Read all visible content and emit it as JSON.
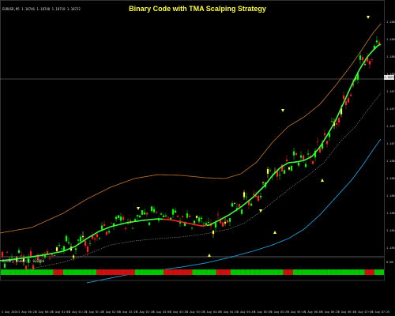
{
  "window": {
    "title": "Binary Code with TMA Scalping Strategy",
    "symbol_info": "EURUSD,M5 1.18746 1.18748 1.18718 1.18722"
  },
  "colors": {
    "background": "#000000",
    "title": "#ffff33",
    "bull_candle": "#00ff00",
    "bear_candle": "#ff2020",
    "neutral_candle": "#ffff44",
    "tma_mid_up": "#44ff44",
    "tma_mid_down": "#ff2a2a",
    "upper_band": "#c8762a",
    "lower_band": "#1e9bd7",
    "inner_band": "#9a9a9a",
    "histogram_green": "#00c800",
    "histogram_red": "#d01010"
  },
  "price_axis": {
    "labels": [
      "1.18895",
      "1.18870",
      "1.18845",
      "1.18820",
      "1.18795",
      "1.18770",
      "1.18745",
      "1.18720",
      "1.18695",
      "1.18670",
      "1.18645",
      "1.18620",
      "1.18595",
      "1.18570"
    ],
    "current_price": "1.18722"
  },
  "time_axis": {
    "labels": [
      "4 Aug 2020",
      "5 Aug 00:25",
      "5 Aug 00:45",
      "5 Aug 01:05",
      "5 Aug 01:25",
      "5 Aug 01:45",
      "5 Aug 02:05",
      "5 Aug 02:25",
      "5 Aug 02:45",
      "5 Aug 03:05",
      "5 Aug 03:25",
      "5 Aug 03:45",
      "5 Aug 04:05",
      "5 Aug 04:25",
      "5 Aug 04:45",
      "5 Aug 05:05",
      "5 Aug 05:25",
      "5 Aug 05:45",
      "5 Aug 06:05",
      "5 Aug 06:25",
      "5 Aug 06:45",
      "5 Aug 07:05",
      "5 Aug 07:25"
    ]
  },
  "indicator": {
    "label": "Binary Code (5) 0.0000",
    "value": "0.00",
    "segments": [
      "green",
      "green",
      "green",
      "green",
      "green",
      "green",
      "green",
      "green",
      "green",
      "green",
      "green",
      "red",
      "red",
      "green",
      "green",
      "green",
      "green",
      "green",
      "green",
      "green",
      "red",
      "red",
      "red",
      "red",
      "red",
      "red",
      "red",
      "red",
      "green",
      "green",
      "green",
      "green",
      "green",
      "green",
      "red",
      "red",
      "red",
      "red",
      "red",
      "red",
      "green",
      "green",
      "green",
      "green",
      "green",
      "red",
      "red",
      "red",
      "green",
      "green",
      "green",
      "green",
      "green",
      "green",
      "green",
      "green",
      "green",
      "green",
      "green",
      "red",
      "red",
      "green",
      "green",
      "green",
      "green",
      "green",
      "green",
      "green",
      "green",
      "green",
      "green",
      "green",
      "green",
      "green",
      "green",
      "green",
      "red",
      "red",
      "green",
      "green"
    ]
  }
}
